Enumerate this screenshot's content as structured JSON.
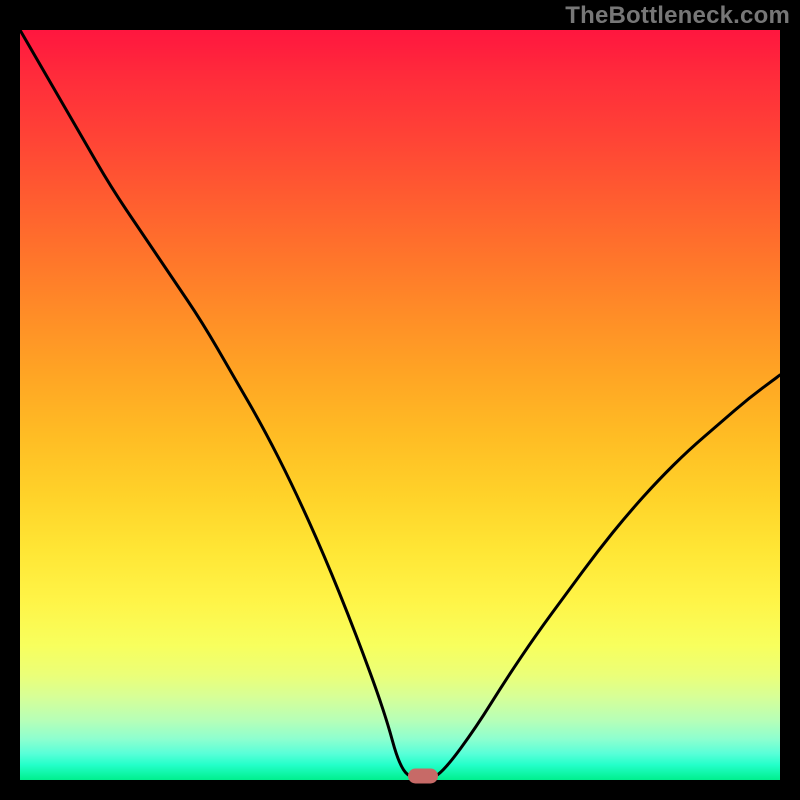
{
  "watermark": "TheBottleneck.com",
  "chart_data": {
    "type": "line",
    "title": "",
    "xlabel": "",
    "ylabel": "",
    "x": [
      0.0,
      0.04,
      0.08,
      0.12,
      0.16,
      0.2,
      0.24,
      0.28,
      0.32,
      0.36,
      0.4,
      0.44,
      0.48,
      0.5,
      0.52,
      0.54,
      0.56,
      0.6,
      0.64,
      0.68,
      0.72,
      0.76,
      0.8,
      0.84,
      0.88,
      0.92,
      0.96,
      1.0
    ],
    "y": [
      1.0,
      0.93,
      0.86,
      0.79,
      0.73,
      0.67,
      0.61,
      0.54,
      0.47,
      0.39,
      0.3,
      0.2,
      0.09,
      0.015,
      0.0,
      0.0,
      0.015,
      0.07,
      0.135,
      0.195,
      0.25,
      0.305,
      0.355,
      0.4,
      0.44,
      0.475,
      0.51,
      0.54
    ],
    "xlim": [
      0,
      1
    ],
    "ylim": [
      0,
      1
    ],
    "marker": {
      "x": 0.53,
      "y": 0.0
    },
    "grid": false,
    "legend": false,
    "background": "rainbow-vertical-gradient"
  }
}
